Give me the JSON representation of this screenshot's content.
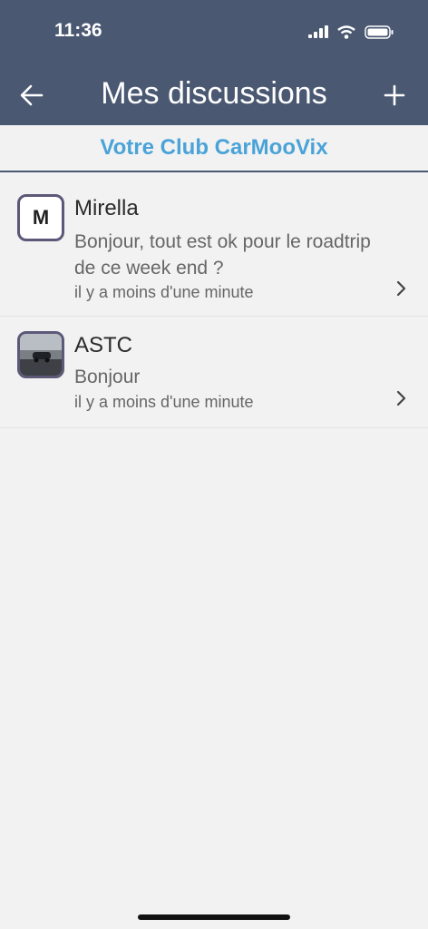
{
  "status_bar": {
    "time": "11:36"
  },
  "nav": {
    "title": "Mes discussions"
  },
  "club": {
    "label": "Votre Club CarMooVix"
  },
  "conversations": [
    {
      "initial": "M",
      "name": "Mirella",
      "message": "Bonjour, tout est ok pour le roadtrip de ce week end ?",
      "time": "il y a moins d'une minute"
    },
    {
      "name": "ASTC",
      "message": "Bonjour",
      "time": "il y a moins d'une minute"
    }
  ],
  "colors": {
    "header": "#4a5872",
    "accent": "#4aa3d8",
    "background": "#f2f2f2"
  }
}
